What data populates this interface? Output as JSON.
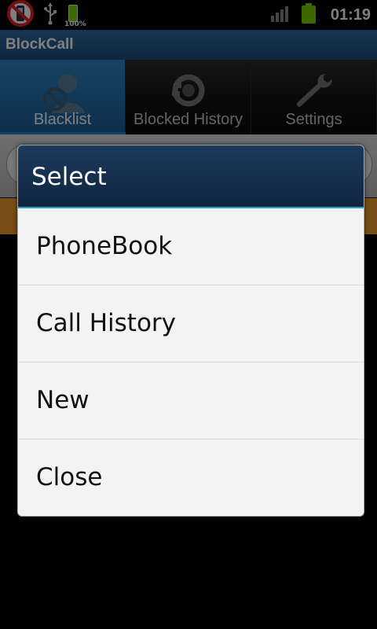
{
  "status_bar": {
    "battery_percent": "100%",
    "time": "01:19",
    "colors": {
      "battery": "#7fd100"
    },
    "icons": [
      "blocked-phone-icon",
      "usb-icon",
      "battery-icon",
      "signal-icon",
      "battery-full-icon"
    ]
  },
  "app": {
    "title": "BlockCall",
    "colors": {
      "title_bar": "#2e6aa4",
      "active_tab": "#2f86c6",
      "accent": "#2a9fd6",
      "button": "#f29a2c"
    }
  },
  "tabs": [
    {
      "label": "Blacklist",
      "icon": "blocked-user-icon",
      "active": true
    },
    {
      "label": "Blocked History",
      "icon": "history-icon",
      "active": false
    },
    {
      "label": "Settings",
      "icon": "wrench-icon",
      "active": false
    }
  ],
  "dialog": {
    "title": "Select",
    "items": [
      {
        "label": "PhoneBook"
      },
      {
        "label": "Call History"
      },
      {
        "label": "New"
      },
      {
        "label": "Close"
      }
    ]
  }
}
